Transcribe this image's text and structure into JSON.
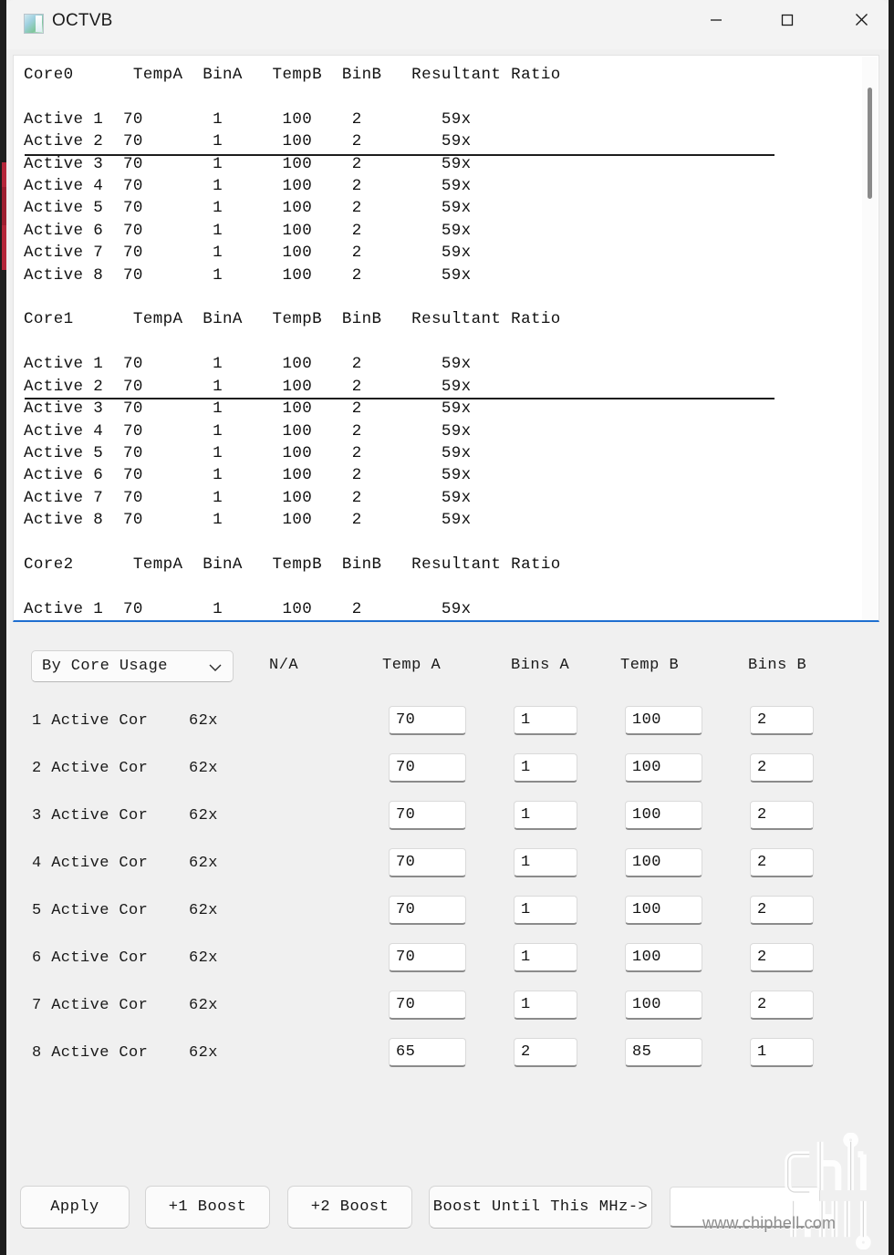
{
  "window": {
    "title": "OCTVB",
    "icon": "app-icon",
    "controls": {
      "minimize": "minimize-icon",
      "maximize": "maximize-icon",
      "close": "close-icon"
    }
  },
  "report": {
    "columns": [
      "Core",
      "TempA",
      "BinA",
      "TempB",
      "BinB",
      "Resultant Ratio"
    ],
    "text": "Core0      TempA  BinA   TempB  BinB   Resultant Ratio\n\nActive 1  70       1      100    2        59x\nActive 2  70       1      100    2        59x\nActive 3  70       1      100    2        59x\nActive 4  70       1      100    2        59x\nActive 5  70       1      100    2        59x\nActive 6  70       1      100    2        59x\nActive 7  70       1      100    2        59x\nActive 8  70       1      100    2        59x\n\nCore1      TempA  BinA   TempB  BinB   Resultant Ratio\n\nActive 1  70       1      100    2        59x\nActive 2  70       1      100    2        59x\nActive 3  70       1      100    2        59x\nActive 4  70       1      100    2        59x\nActive 5  70       1      100    2        59x\nActive 6  70       1      100    2        59x\nActive 7  70       1      100    2        59x\nActive 8  70       1      100    2        59x\n\nCore2      TempA  BinA   TempB  BinB   Resultant Ratio\n\nActive 1  70       1      100    2        59x",
    "scrollbar": "vertical-scrollbar"
  },
  "config": {
    "mode": {
      "selected": "By Core Usage",
      "chevron": "chevron-down-icon"
    },
    "headers": {
      "na": "N/A",
      "temp_a": "Temp A",
      "bins_a": "Bins A",
      "temp_b": "Temp B",
      "bins_b": "Bins B"
    },
    "rows": [
      {
        "label": "1 Active Cor",
        "ratio": "62x",
        "temp_a": "70",
        "bins_a": "1",
        "temp_b": "100",
        "bins_b": "2"
      },
      {
        "label": "2 Active Cor",
        "ratio": "62x",
        "temp_a": "70",
        "bins_a": "1",
        "temp_b": "100",
        "bins_b": "2"
      },
      {
        "label": "3 Active Cor",
        "ratio": "62x",
        "temp_a": "70",
        "bins_a": "1",
        "temp_b": "100",
        "bins_b": "2"
      },
      {
        "label": "4 Active Cor",
        "ratio": "62x",
        "temp_a": "70",
        "bins_a": "1",
        "temp_b": "100",
        "bins_b": "2"
      },
      {
        "label": "5 Active Cor",
        "ratio": "62x",
        "temp_a": "70",
        "bins_a": "1",
        "temp_b": "100",
        "bins_b": "2"
      },
      {
        "label": "6 Active Cor",
        "ratio": "62x",
        "temp_a": "70",
        "bins_a": "1",
        "temp_b": "100",
        "bins_b": "2"
      },
      {
        "label": "7 Active Cor",
        "ratio": "62x",
        "temp_a": "70",
        "bins_a": "1",
        "temp_b": "100",
        "bins_b": "2"
      },
      {
        "label": "8 Active Cor",
        "ratio": "62x",
        "temp_a": "65",
        "bins_a": "2",
        "temp_b": "85",
        "bins_b": "1"
      }
    ]
  },
  "buttons": {
    "apply": "Apply",
    "boost_plus1": "+1 Boost",
    "boost_plus2": "+2 Boost",
    "boost_until_mhz": "Boost Until This MHz->",
    "mhz_value": ""
  },
  "watermark": {
    "url": "www.chiphell.com",
    "logo": "chiphell-logo"
  },
  "colors": {
    "accent_focus": "#1f6fd0",
    "window_bg": "#f0f0f0",
    "panel_bg": "#ffffff",
    "text": "#111111"
  }
}
